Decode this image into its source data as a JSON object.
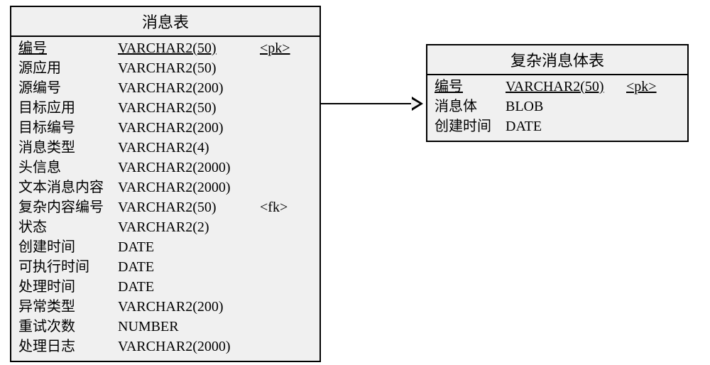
{
  "tables": {
    "message": {
      "title": "消息表",
      "columns": [
        {
          "name": "编号",
          "type": "VARCHAR2(50)",
          "key": "<pk>",
          "underline": true
        },
        {
          "name": "源应用",
          "type": "VARCHAR2(50)",
          "key": ""
        },
        {
          "name": "源编号",
          "type": "VARCHAR2(200)",
          "key": ""
        },
        {
          "name": "目标应用",
          "type": "VARCHAR2(50)",
          "key": ""
        },
        {
          "name": "目标编号",
          "type": "VARCHAR2(200)",
          "key": ""
        },
        {
          "name": "消息类型",
          "type": "VARCHAR2(4)",
          "key": ""
        },
        {
          "name": "头信息",
          "type": "VARCHAR2(2000)",
          "key": ""
        },
        {
          "name": "文本消息内容",
          "type": "VARCHAR2(2000)",
          "key": ""
        },
        {
          "name": "复杂内容编号",
          "type": "VARCHAR2(50)",
          "key": "<fk>"
        },
        {
          "name": "状态",
          "type": "VARCHAR2(2)",
          "key": ""
        },
        {
          "name": "创建时间",
          "type": "DATE",
          "key": ""
        },
        {
          "name": "可执行时间",
          "type": "DATE",
          "key": ""
        },
        {
          "name": "处理时间",
          "type": "DATE",
          "key": ""
        },
        {
          "name": "异常类型",
          "type": "VARCHAR2(200)",
          "key": ""
        },
        {
          "name": "重试次数",
          "type": "NUMBER",
          "key": ""
        },
        {
          "name": "处理日志",
          "type": "VARCHAR2(2000)",
          "key": ""
        }
      ]
    },
    "complex_body": {
      "title": "复杂消息体表",
      "columns": [
        {
          "name": "编号",
          "type": "VARCHAR2(50)",
          "key": "<pk>",
          "underline": true
        },
        {
          "name": "消息体",
          "type": "BLOB",
          "key": ""
        },
        {
          "name": "创建时间",
          "type": "DATE",
          "key": ""
        }
      ]
    }
  }
}
